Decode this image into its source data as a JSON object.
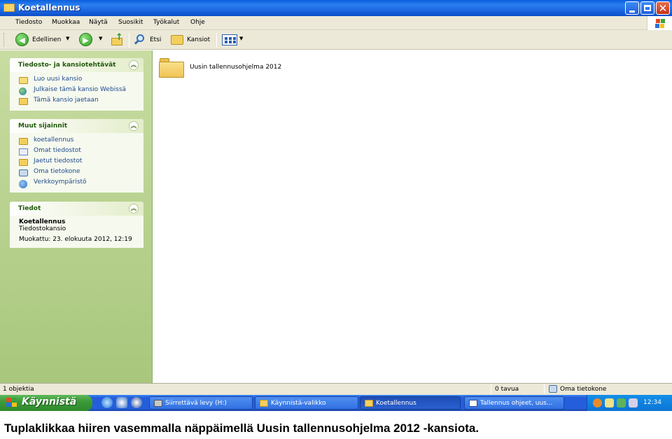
{
  "window": {
    "title": "Koetallennus"
  },
  "menubar": {
    "items": [
      "Tiedosto",
      "Muokkaa",
      "Näytä",
      "Suosikit",
      "Työkalut",
      "Ohje"
    ]
  },
  "toolbar": {
    "back_label": "Edellinen",
    "search_label": "Etsi",
    "folders_label": "Kansiot"
  },
  "tasks_panel": {
    "title": "Tiedosto- ja kansiotehtävät",
    "items": [
      "Luo uusi kansio",
      "Julkaise tämä kansio Webissä",
      "Tämä kansio jaetaan"
    ]
  },
  "other_places_panel": {
    "title": "Muut sijainnit",
    "items": [
      "koetallennus",
      "Omat tiedostot",
      "Jaetut tiedostot",
      "Oma tietokone",
      "Verkkoympäristö"
    ]
  },
  "details_panel": {
    "title": "Tiedot",
    "name": "Koetallennus",
    "type": "Tiedostokansio",
    "modified": "Muokattu: 23. elokuuta 2012, 12:19"
  },
  "content": {
    "folders": [
      {
        "name": "Uusin tallennusohjelma 2012",
        "icon": "folder-icon"
      }
    ]
  },
  "statusbar": {
    "objects": "1 objektia",
    "size": "0 tavua",
    "location": "Oma tietokone"
  },
  "taskbar": {
    "start_label": "Käynnistä",
    "buttons": [
      "Siirrettävä levy (H:)",
      "Käynnistä-valikko",
      "Koetallennus",
      "Tallennus ohjeet, uus..."
    ],
    "clock": "12:34"
  },
  "caption": "Tuplaklikkaa hiiren vasemmalla näppäimellä Uusin tallennusohjelma 2012 -kansiota.",
  "colors": {
    "titlebar": "#0a5fdd",
    "taskpane": "#c8dca2",
    "taskbar": "#245edb",
    "start": "#3c9a39"
  }
}
